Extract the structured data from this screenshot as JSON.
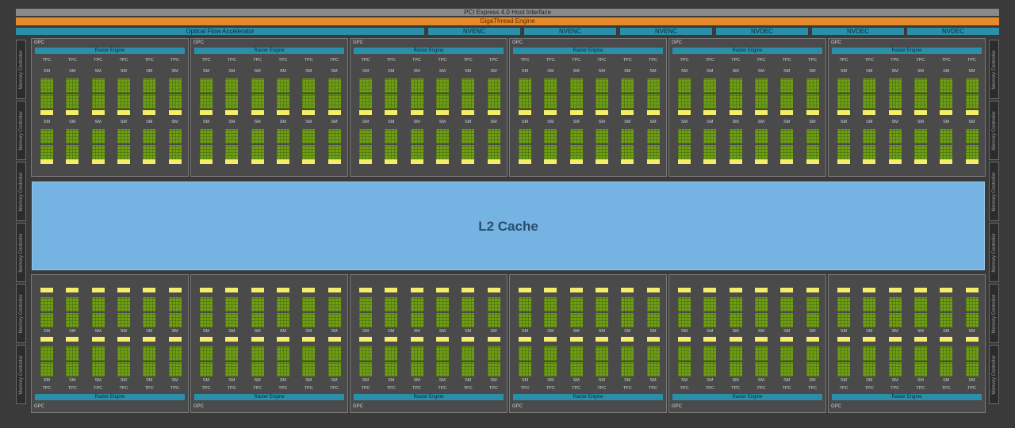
{
  "header": {
    "pcie": "PCI Express 4.0 Host Interface",
    "gigathread": "GigaThread Engine",
    "ofa": "Optical Flow Accelerator",
    "codecs": [
      "NVENC",
      "NVENC",
      "NVENC",
      "NVDEC",
      "NVDEC",
      "NVDEC"
    ]
  },
  "memory_controller_label": "Memory Controller",
  "gpc_label": "GPC",
  "raster_label": "Raster Engine",
  "tpc_label": "TPC",
  "sm_label": "SM",
  "l2_label": "L2 Cache",
  "colors": {
    "background": "#3a3a3a",
    "gpc": "#4a4a4a",
    "cores": "#6f9e16",
    "cache": "#f2ee6a",
    "engine": "#2b8faa",
    "gigathread": "#e58a2a",
    "l2": "#74b3e2"
  },
  "gpc_count": 12,
  "tpc_per_gpc": 6
}
